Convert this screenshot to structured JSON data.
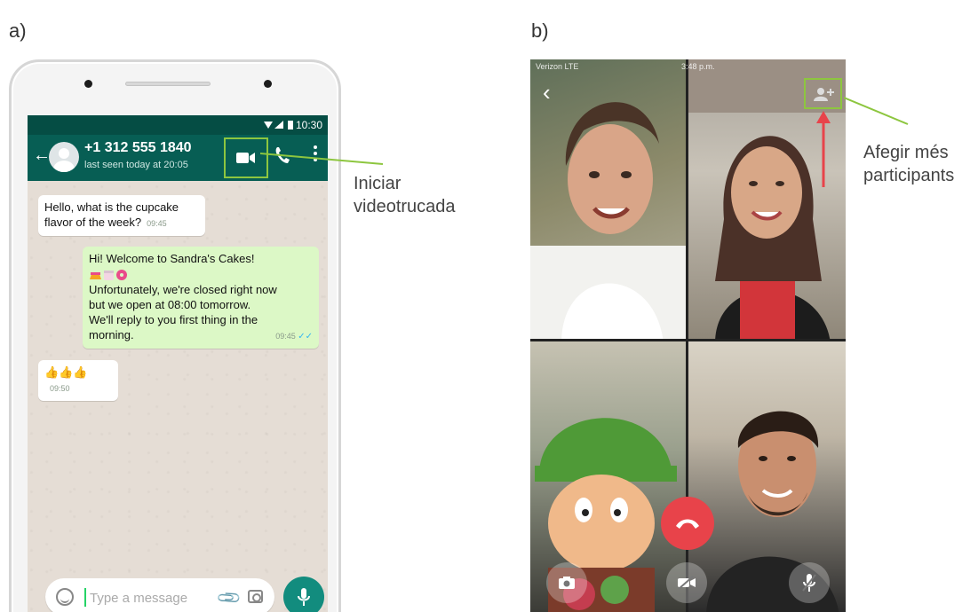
{
  "labels": {
    "panel_a": "a)",
    "panel_b": "b)"
  },
  "whatsapp": {
    "status_time": "10:30",
    "contact_name": "+1 312 555 1840",
    "last_seen": "last seen today at 20:05",
    "messages": [
      {
        "direction": "in",
        "lines": [
          "Hello, what is the cupcake",
          "flavor of the week?"
        ],
        "time": "09:45"
      },
      {
        "direction": "out",
        "lines": [
          "Hi! Welcome to Sandra's Cakes!",
          "Unfortunately, we're closed right now",
          "but we open at 08:00 tomorrow.",
          "We'll reply to you first thing in the",
          "morning."
        ],
        "time": "09:45"
      },
      {
        "direction": "in",
        "emoji": "👍👍👍",
        "time": "09:50"
      }
    ],
    "input_placeholder": "Type a message",
    "icons": [
      "back-arrow-icon",
      "video-call-icon",
      "phone-icon",
      "menu-icon",
      "smiley-icon",
      "attach-icon",
      "camera-icon",
      "mic-icon"
    ]
  },
  "callouts": {
    "start_video_call": [
      "Iniciar",
      "videotrucada"
    ],
    "add_participants": [
      "Afegir més",
      "participants"
    ]
  },
  "video_call": {
    "carrier": "Verizon LTE",
    "time": "3:48 p.m.",
    "icons": [
      "back-chevron-icon",
      "add-participant-icon",
      "end-call-icon",
      "switch-camera-icon",
      "video-off-icon",
      "mute-icon"
    ]
  },
  "colors": {
    "whatsapp_header": "#075e54",
    "outgoing_bubble": "#dcf8c6",
    "highlight_green": "#8dc63f",
    "end_call_red": "#e8434a",
    "arrow_red": "#e8434a"
  }
}
